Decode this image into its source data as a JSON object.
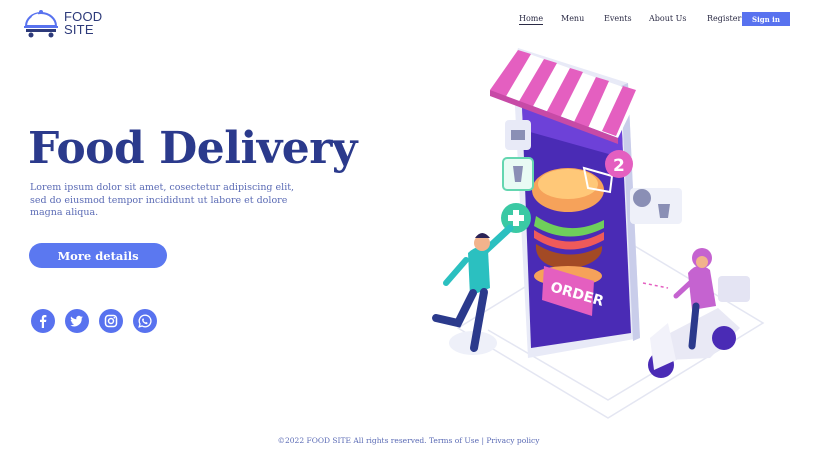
{
  "brand": {
    "line1": "FOOD",
    "line2": "SITE"
  },
  "nav": {
    "items": [
      {
        "label": "Home"
      },
      {
        "label": "Menu"
      },
      {
        "label": "Events"
      },
      {
        "label": "About Us"
      }
    ],
    "register_label": "Register",
    "signin_label": "Sign in"
  },
  "hero": {
    "title": "Food Delivery",
    "description": "Lorem ipsum dolor sit amet, cosectetur adipiscing elit, sed do eiusmod tempor incididunt ut labore et dolore magna aliqua.",
    "button_label": "More details"
  },
  "social": [
    "facebook-icon",
    "twitter-icon",
    "instagram-icon",
    "whatsapp-icon"
  ],
  "illustration": {
    "order_label": "ORDER",
    "badge_count": "2"
  },
  "footer": {
    "copyright": "©2022 FOOD SITE All rights reserved.",
    "terms_label": "Terms of Use",
    "separator": "|",
    "privacy_label": "Privacy policy"
  },
  "colors": {
    "brand_blue": "#5872ef",
    "title_navy": "#2b3a8c",
    "text_blue": "#5b6bb5",
    "awning_pink": "#e45fc0",
    "phone_purple": "#4a2bb5"
  }
}
